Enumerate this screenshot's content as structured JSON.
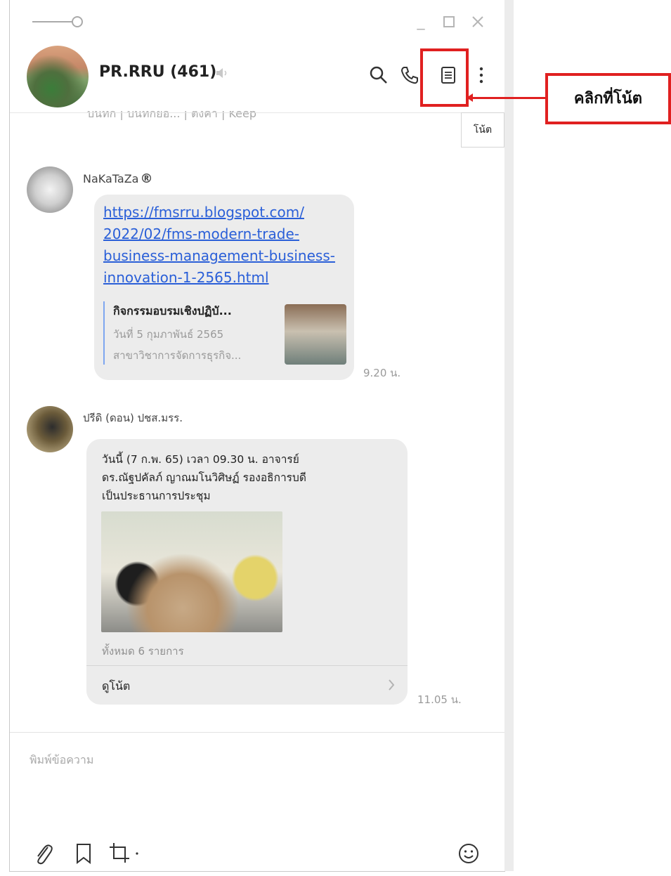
{
  "chat": {
    "title": "PR.RRU (461)",
    "header_subtitle_row": "บันทึก | บันทึกย่อ... | ตั้งค่า | Keep"
  },
  "tooltip": "โน้ต",
  "annotation": {
    "callout_text": "คลิกที่โน้ต",
    "accent_color": "#e02020"
  },
  "messages": [
    {
      "sender": "NaKaTaZa",
      "sender_badge": "®",
      "link_lines": [
        "https://fmsrru.blogspot.com/",
        "2022/02/fms-modern-trade-",
        "business-management-business-",
        "innovation-1-2565.html"
      ],
      "preview": {
        "title": "กิจกรรมอบรมเชิงปฏิบั...",
        "line1": "วันที่ 5 กุมภาพันธ์ 2565",
        "line2": "สาขาวิชาการจัดการธุรกิจ..."
      },
      "time": "9.20 น."
    },
    {
      "sender": "ปรีดิ (ดอน) ปชส.มรร.",
      "text_lines": [
        "วันนี้ (7 ก.พ. 65) เวลา 09.30 น. อาจารย์",
        "ดร.ณัฐปคัลภ์ ญาณมโนวิศิษฏ์ รองอธิการบดี",
        "เป็นประธานการประชุม"
      ],
      "image_count_label": "ทั้งหมด 6 รายการ",
      "view_note_label": "ดูโน้ต",
      "time": "11.05 น."
    }
  ],
  "composer": {
    "placeholder": "พิมพ์ข้อความ"
  },
  "icons": [
    "pin-icon",
    "minimize-icon",
    "maximize-icon",
    "close-icon",
    "speaker-muted-icon",
    "search-icon",
    "phone-icon",
    "note-icon",
    "more-icon",
    "attach-icon",
    "bookmark-icon",
    "screenshot-icon",
    "emoji-icon",
    "chevron-right-icon"
  ]
}
